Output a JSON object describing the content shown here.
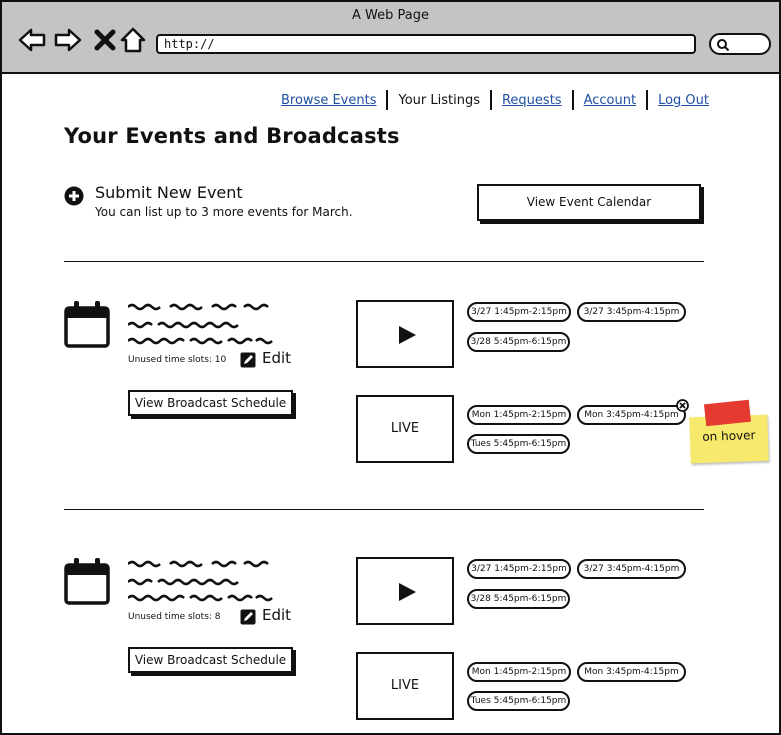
{
  "window": {
    "title": "A Web Page",
    "url": "http://"
  },
  "nav": {
    "browse_events": "Browse Events",
    "your_listings": "Your Listings",
    "requests": "Requests",
    "account": "Account",
    "log_out": "Log Out"
  },
  "page": {
    "title": "Your Events and Broadcasts",
    "submit_title": "Submit New Event",
    "submit_subtitle": "You can list up to 3 more events for March.",
    "view_calendar": "View Event Calendar"
  },
  "events": [
    {
      "unused_slots": "Unused time slots: 10",
      "edit_label": "Edit",
      "schedule_button": "View Broadcast Schedule",
      "video_slots": [
        "3/27 1:45pm-2:15pm",
        "3/27 3:45pm-4:15pm",
        "3/28 5:45pm-6:15pm"
      ],
      "live_label": "LIVE",
      "live_slots": [
        "Mon 1:45pm-2:15pm",
        "Mon 3:45pm-4:15pm",
        "Tues 5:45pm-6:15pm"
      ]
    },
    {
      "unused_slots": "Unused time slots: 8",
      "edit_label": "Edit",
      "schedule_button": "View Broadcast Schedule",
      "video_slots": [
        "3/27 1:45pm-2:15pm",
        "3/27 3:45pm-4:15pm",
        "3/28 5:45pm-6:15pm"
      ],
      "live_label": "LIVE",
      "live_slots": [
        "Mon 1:45pm-2:15pm",
        "Mon 3:45pm-4:15pm",
        "Tues 5:45pm-6:15pm"
      ]
    }
  ],
  "sticky_note": "on hover",
  "colors": {
    "link": "#1f4fa0",
    "chrome": "#c4c4c4",
    "sticky": "#f6e96b",
    "tape": "#e43a2f"
  }
}
